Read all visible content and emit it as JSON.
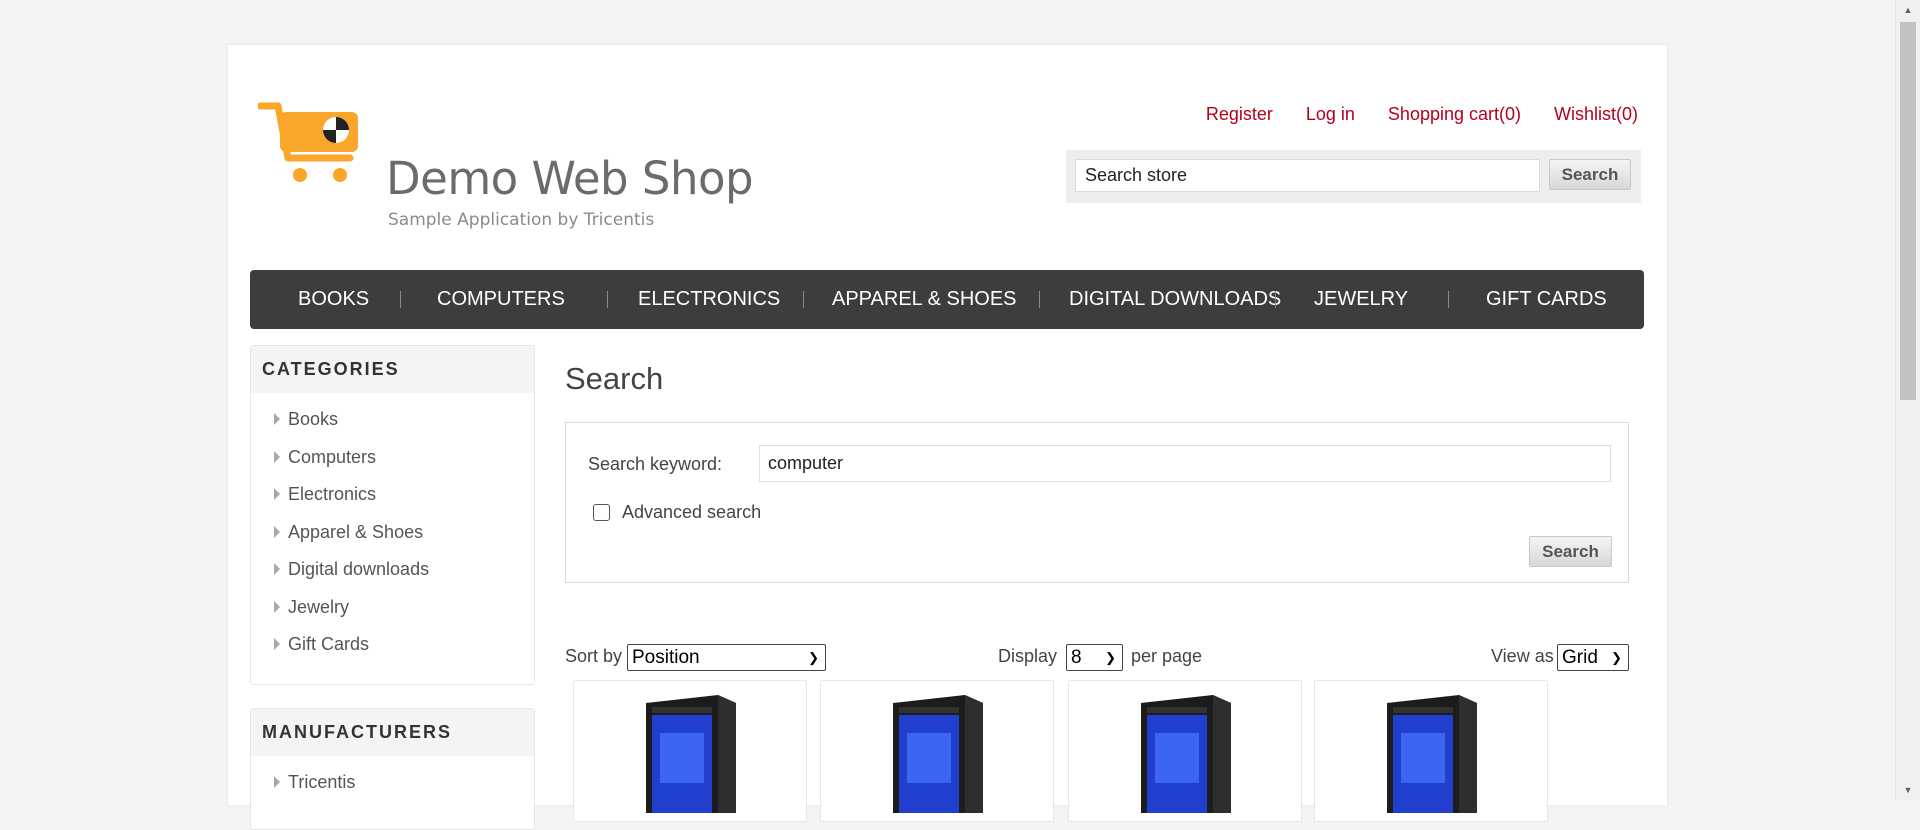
{
  "header": {
    "shop_name": "Demo Web Shop",
    "tagline": "Sample Application by Tricentis",
    "links": {
      "register": "Register",
      "login": "Log in",
      "cart": "Shopping cart(0)",
      "wishlist": "Wishlist(0)"
    },
    "search": {
      "placeholder": "Search store",
      "value": "Search store",
      "button": "Search"
    }
  },
  "top_menu": [
    "BOOKS",
    "COMPUTERS",
    "ELECTRONICS",
    "APPAREL & SHOES",
    "DIGITAL DOWNLOADS",
    "JEWELRY",
    "GIFT CARDS"
  ],
  "sidebar": {
    "categories_title": "CATEGORIES",
    "categories": [
      "Books",
      "Computers",
      "Electronics",
      "Apparel & Shoes",
      "Digital downloads",
      "Jewelry",
      "Gift Cards"
    ],
    "manufacturers_title": "MANUFACTURERS",
    "manufacturers": [
      "Tricentis"
    ]
  },
  "main": {
    "title": "Search",
    "keyword_label": "Search keyword:",
    "keyword_value": "computer",
    "advanced_label": "Advanced search",
    "advanced_checked": false,
    "search_button": "Search",
    "sort_label": "Sort by",
    "sort_value": "Position",
    "display_label": "Display",
    "display_value": "8",
    "per_page_label": "per page",
    "view_label": "View as",
    "view_value": "Grid"
  },
  "products": [
    {
      "image": "desktop-pc-image"
    },
    {
      "image": "desktop-pc-image"
    },
    {
      "image": "desktop-pc-image"
    },
    {
      "image": "desktop-pc-image"
    }
  ],
  "colors": {
    "accent_link": "#b5001c",
    "menu_bg": "#3d3d3d",
    "logo_orange": "#f9a62b"
  }
}
